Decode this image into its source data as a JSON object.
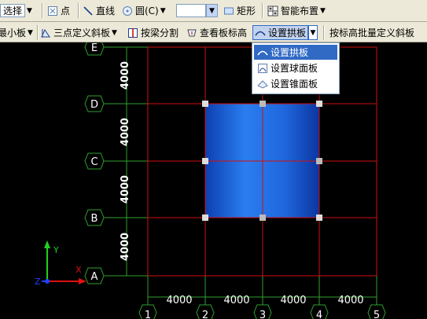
{
  "toolbar1": {
    "select_label": "选择",
    "point_label": "点",
    "line_label": "直线",
    "circle_label": "圆(C)",
    "rect_label": "矩形",
    "smart_label": "智能布置"
  },
  "toolbar2": {
    "small_board_label": "最小板",
    "three_point_label": "三点定义斜板",
    "split_by_beam_label": "按梁分割",
    "view_height_label": "查看板标高",
    "set_arch_label": "设置拱板",
    "batch_slope_label": "按标高批量定义斜板"
  },
  "dropdown": {
    "items": [
      "设置拱板",
      "设置球面板",
      "设置锥面板"
    ],
    "selected_index": 0
  },
  "axes": {
    "rows": [
      "E",
      "D",
      "C",
      "B",
      "A"
    ],
    "columns": [
      "1",
      "2",
      "3",
      "4",
      "5"
    ],
    "row_spacings": [
      "4000",
      "4000",
      "4000",
      "4000"
    ],
    "column_spacings": [
      "4000",
      "4000",
      "4000",
      "4000"
    ]
  },
  "ucs": {
    "x": "X",
    "y": "Y",
    "z": "Z"
  },
  "colors": {
    "grid": "#d01010",
    "dim": "#2fa02f",
    "slab": "#1a5fd0",
    "highlight": "#316ac5"
  }
}
